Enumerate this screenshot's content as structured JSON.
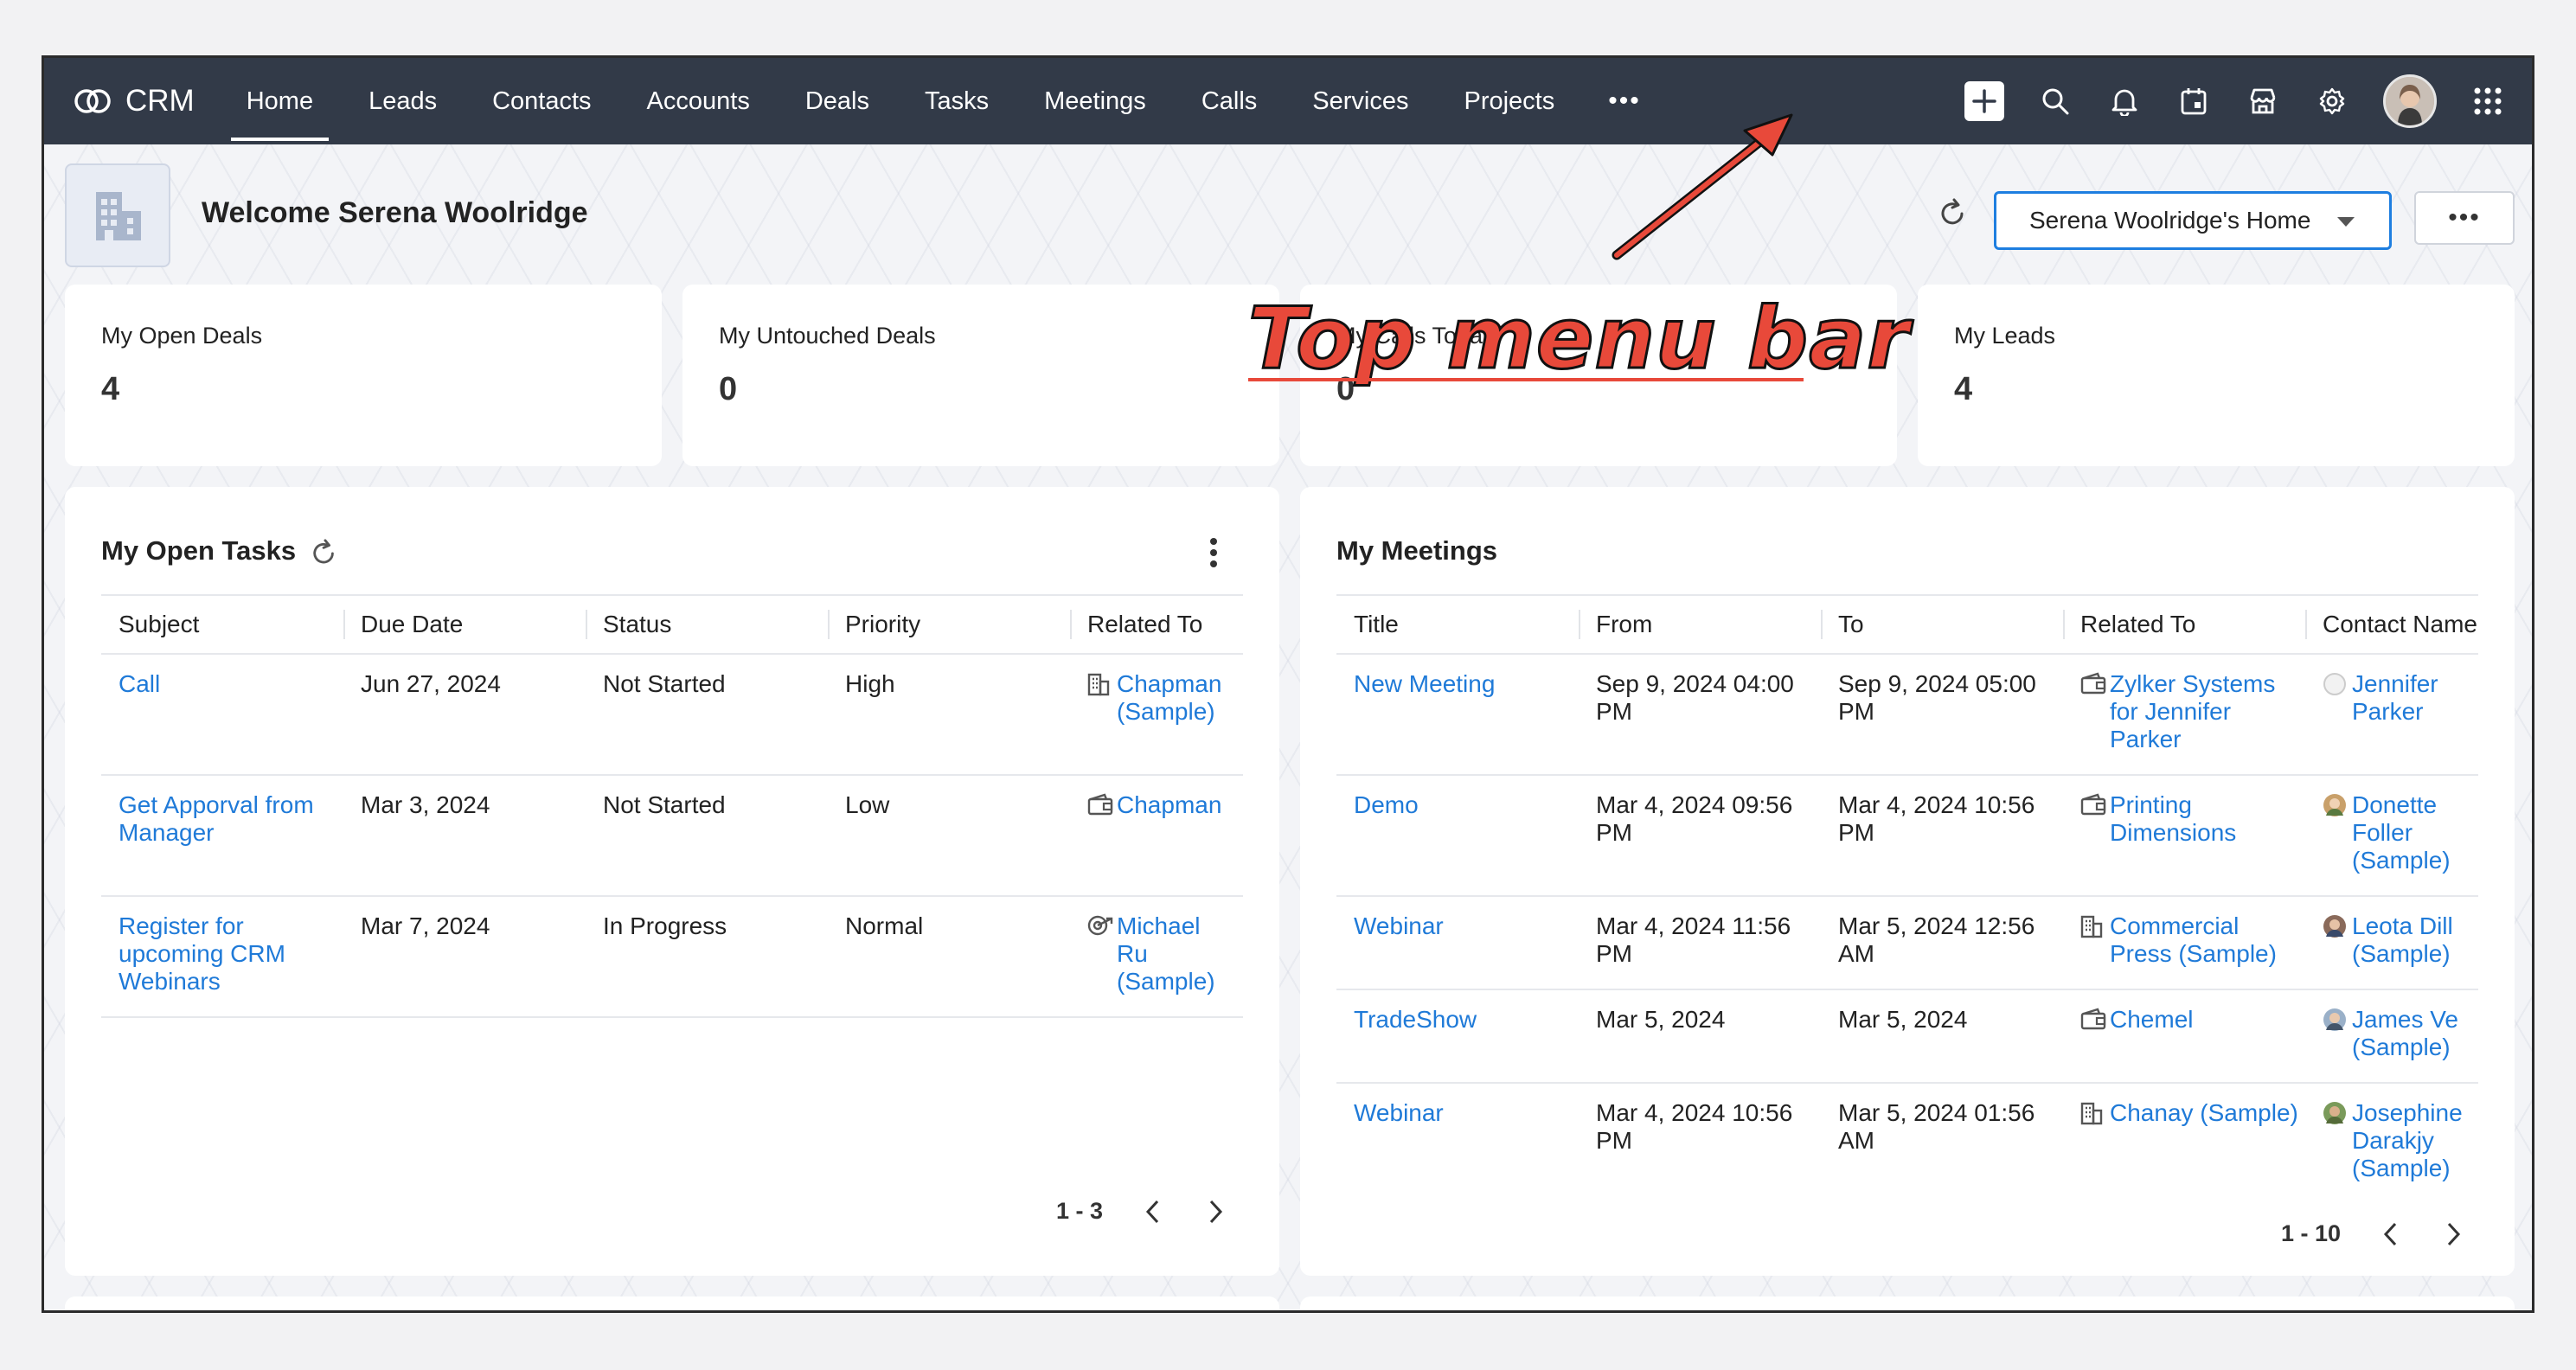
{
  "app": {
    "name": "CRM"
  },
  "nav": {
    "items": [
      "Home",
      "Leads",
      "Contacts",
      "Accounts",
      "Deals",
      "Tasks",
      "Meetings",
      "Calls",
      "Services",
      "Projects"
    ],
    "active": "Home",
    "more": "•••"
  },
  "topbar_icons": [
    "plus-icon",
    "search-icon",
    "bell-icon",
    "calendar-icon",
    "marketplace-icon",
    "gear-icon",
    "avatar",
    "apps-grid-icon"
  ],
  "header": {
    "welcome": "Welcome Serena Woolridge",
    "home_select": "Serena Woolridge's Home",
    "more": "•••"
  },
  "stats": [
    {
      "label": "My Open Deals",
      "value": "4"
    },
    {
      "label": "My Untouched Deals",
      "value": "0"
    },
    {
      "label": "My Calls Today",
      "value": "0"
    },
    {
      "label": "My Leads",
      "value": "4"
    }
  ],
  "tasks": {
    "title": "My Open Tasks",
    "columns": [
      "Subject",
      "Due Date",
      "Status",
      "Priority",
      "Related To"
    ],
    "rows": [
      {
        "subject": "Call",
        "due": "Jun 27, 2024",
        "status": "Not Started",
        "priority": "High",
        "related": "Chapman (Sample)",
        "related_icon": "building-icon"
      },
      {
        "subject": "Get Apporval from Manager",
        "due": "Mar 3, 2024",
        "status": "Not Started",
        "priority": "Low",
        "related": "Chapman",
        "related_icon": "deal-icon"
      },
      {
        "subject": "Register for upcoming CRM Webinars",
        "due": "Mar 7, 2024",
        "status": "In Progress",
        "priority": "Normal",
        "related": "Michael Ru (Sample)",
        "related_icon": "lead-icon"
      }
    ],
    "pager": "1 - 3"
  },
  "meetings": {
    "title": "My Meetings",
    "columns": [
      "Title",
      "From",
      "To",
      "Related To",
      "Contact Name"
    ],
    "rows": [
      {
        "title": "New Meeting",
        "from": "Sep 9, 2024 04:00 PM",
        "to": "Sep 9, 2024 05:00 PM",
        "related": "Zylker Systems for Jennifer Parker",
        "related_icon": "deal-icon",
        "contact": "Jennifer Parker"
      },
      {
        "title": "Demo",
        "from": "Mar 4, 2024 09:56 PM",
        "to": "Mar 4, 2024 10:56 PM",
        "related": "Printing Dimensions",
        "related_icon": "deal-icon",
        "contact": "Donette Foller (Sample)"
      },
      {
        "title": "Webinar",
        "from": "Mar 4, 2024 11:56 PM",
        "to": "Mar 5, 2024 12:56 AM",
        "related": "Commercial Press (Sample)",
        "related_icon": "building-icon",
        "contact": "Leota Dill (Sample)"
      },
      {
        "title": "TradeShow",
        "from": "Mar 5, 2024",
        "to": "Mar 5, 2024",
        "related": "Chemel",
        "related_icon": "deal-icon",
        "contact": "James Ve (Sample)"
      },
      {
        "title": "Webinar",
        "from": "Mar 4, 2024 10:56 PM",
        "to": "Mar 5, 2024 01:56 AM",
        "related": "Chanay (Sample)",
        "related_icon": "building-icon",
        "contact": "Josephine Darakjy (Sample)"
      }
    ],
    "pager": "1 - 10"
  },
  "annotation": {
    "text": "Top menu bar",
    "color": "#e8493a"
  },
  "colors": {
    "topbar": "#323a48",
    "link": "#1f7ad8",
    "accent": "#1e7ee0"
  }
}
